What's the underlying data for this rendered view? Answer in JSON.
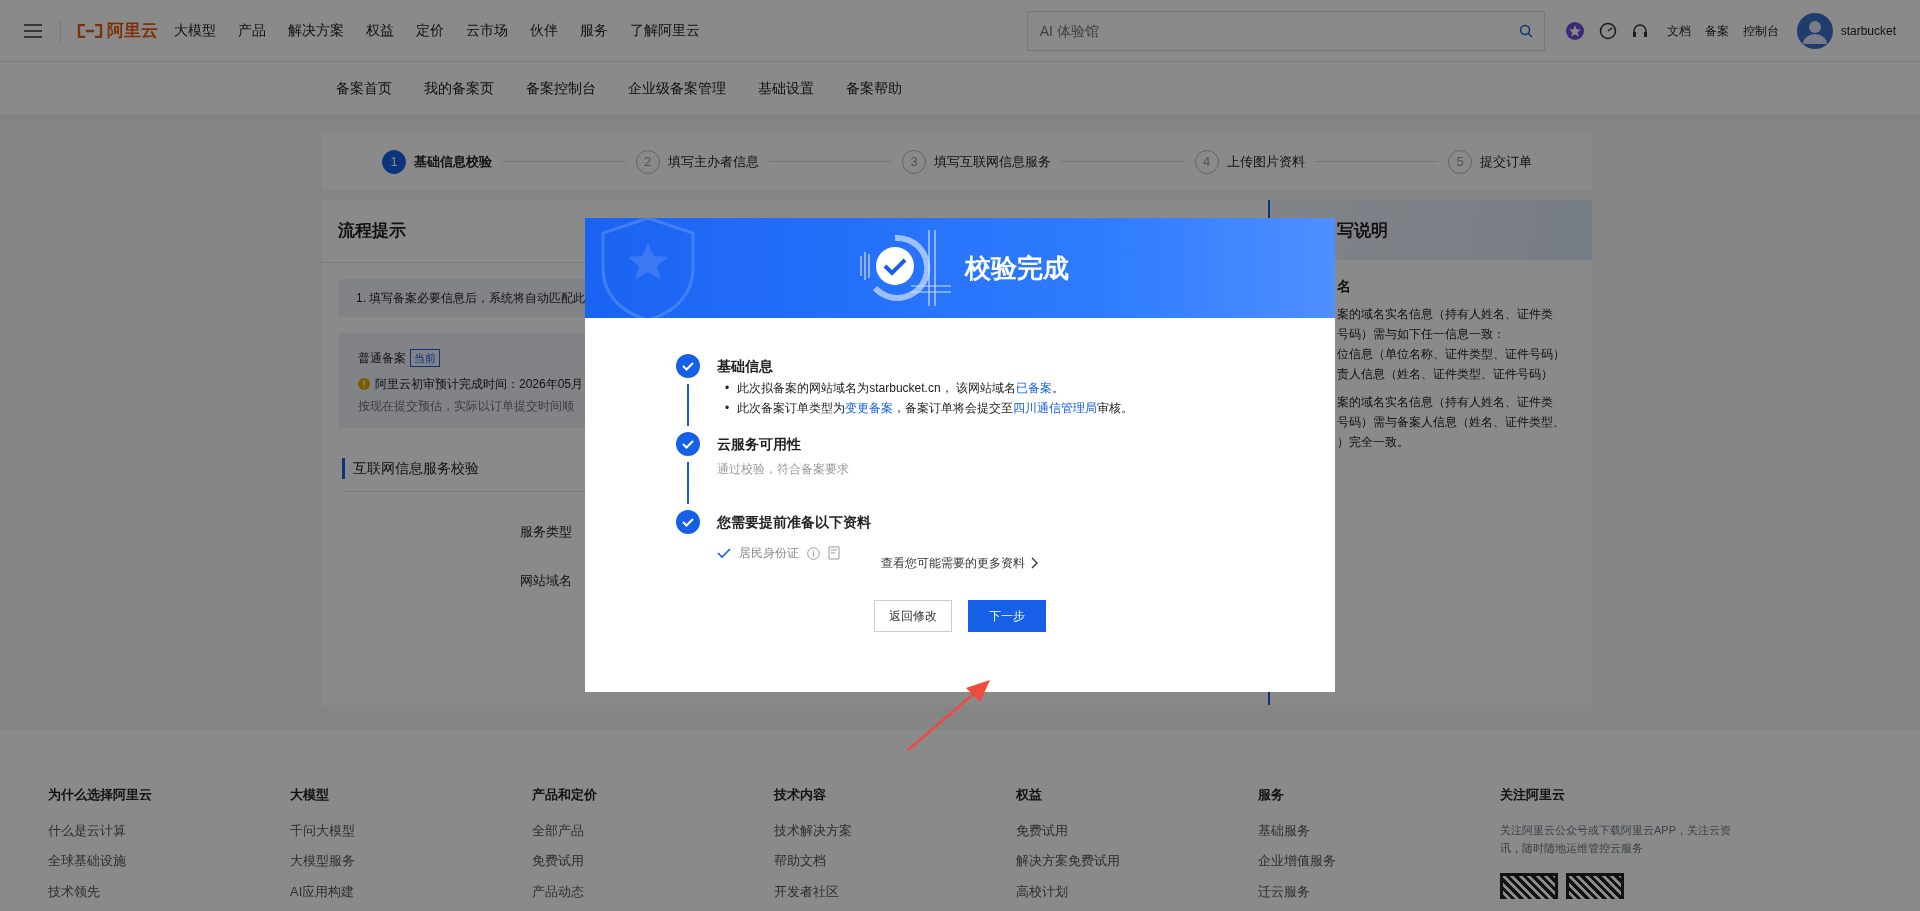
{
  "top_nav": {
    "logo_text": "阿里云",
    "items": [
      "大模型",
      "产品",
      "解决方案",
      "权益",
      "定价",
      "云市场",
      "伙伴",
      "服务",
      "了解阿里云"
    ],
    "search": {
      "placeholder": "AI 体验馆"
    },
    "links": [
      "文档",
      "备案",
      "控制台"
    ],
    "username": "starbucket"
  },
  "sub_nav": {
    "items": [
      "备案首页",
      "我的备案页",
      "备案控制台",
      "企业级备案管理",
      "基础设置",
      "备案帮助"
    ]
  },
  "steps": [
    {
      "number": "1",
      "label": "基础信息校验",
      "selected": true
    },
    {
      "number": "2",
      "label": "填写主办者信息",
      "selected": false
    },
    {
      "number": "3",
      "label": "填写互联网信息服务",
      "selected": false
    },
    {
      "number": "4",
      "label": "上传图片资料",
      "selected": false
    },
    {
      "number": "5",
      "label": "提交订单",
      "selected": false
    }
  ],
  "left_panel": {
    "title": "流程提示",
    "tip": "1. 填写备案必要信息后，系统将自动匹配此",
    "plan": {
      "name": "普通备案",
      "badge": "当前",
      "eta_label": "阿里云初审预计完成时间：",
      "eta_value": "2026年05月",
      "note": "按现在提交预估，实际以订单提交时间顺"
    },
    "section_title": "互联网信息服务校验",
    "fields": [
      "服务类型",
      "网站域名"
    ]
  },
  "right_panel": {
    "title": "写说明",
    "subtitle": "名",
    "paragraphs": [
      [
        "案的域名实名信息（持有人姓名、证件类",
        "号码）需与如下任一信息一致：",
        "位信息（单位名称、证件类型、证件号码）",
        "责人信息（姓名、证件类型、证件号码）"
      ],
      [
        "案的域名实名信息（持有人姓名、证件类",
        "号码）需与备案人信息（姓名、证件类型、",
        "）完全一致。"
      ]
    ]
  },
  "modal": {
    "title": "校验完成",
    "checks": [
      {
        "kind": "bullets",
        "title": "基础信息",
        "marker": "•",
        "bullets": [
          [
            {
              "text": "此次拟备案的网站域名为starbucket.cn， 该网站域名"
            },
            {
              "text": "已备案",
              "link": true
            },
            {
              "text": "。"
            }
          ],
          [
            {
              "text": "此次备案订单类型为"
            },
            {
              "text": "变更备案",
              "link": true
            },
            {
              "text": "，备案订单将会提交至"
            },
            {
              "text": "四川通信管理局",
              "link": true
            },
            {
              "text": "审核。"
            }
          ]
        ]
      },
      {
        "kind": "note",
        "title": "云服务可用性",
        "note": "通过校验，符合备案要求"
      },
      {
        "kind": "documents",
        "title": "您需要提前准备以下资料",
        "documents": [
          {
            "label": "居民身份证",
            "checked": true
          }
        ]
      }
    ],
    "more_link": "查看您可能需要的更多资料",
    "buttons": [
      {
        "label": "返回修改",
        "kind": "secondary"
      },
      {
        "label": "下一步",
        "kind": "primary"
      }
    ]
  },
  "footer": {
    "columns": [
      {
        "title": "为什么选择阿里云",
        "items": [
          "什么是云计算",
          "全球基础设施",
          "技术领先"
        ]
      },
      {
        "title": "大模型",
        "items": [
          "千问大模型",
          "大模型服务",
          "AI应用构建"
        ]
      },
      {
        "title": "产品和定价",
        "items": [
          "全部产品",
          "免费试用",
          "产品动态"
        ]
      },
      {
        "title": "技术内容",
        "items": [
          "技术解决方案",
          "帮助文档",
          "开发者社区"
        ]
      },
      {
        "title": "权益",
        "items": [
          "免费试用",
          "解决方案免费试用",
          "高校计划"
        ]
      },
      {
        "title": "服务",
        "items": [
          "基础服务",
          "企业增值服务",
          "迁云服务"
        ]
      }
    ],
    "follow": {
      "title": "关注阿里云",
      "text": "关注阿里云公众号或下载阿里云APP，关注云资讯，随时随地运维管控云服务"
    }
  }
}
